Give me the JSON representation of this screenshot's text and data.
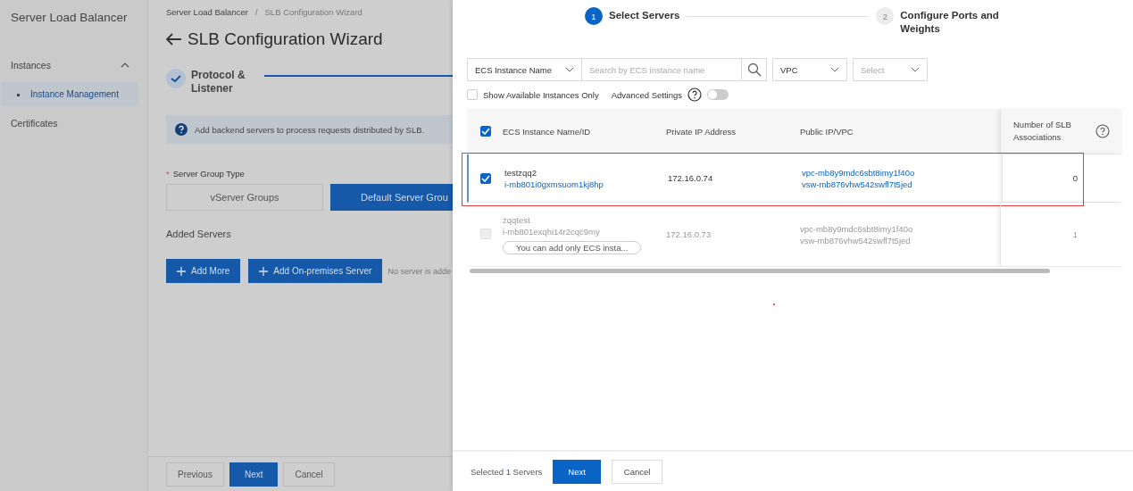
{
  "sidebar": {
    "title": "Server Load Balancer",
    "group": {
      "label": "Instances",
      "expanded": true
    },
    "items": [
      {
        "label": "Instance Management",
        "selected": true
      }
    ],
    "links": [
      "Certificates"
    ]
  },
  "page": {
    "breadcrumb": [
      "Server Load Balancer",
      "SLB Configuration Wizard"
    ],
    "breadcrumb_separator": "/",
    "required_mark": "*",
    "title": "SLB Configuration Wizard",
    "step": {
      "label": "Protocol & Listener",
      "done": true
    },
    "notice": "Add backend servers to process requests distributed by SLB.",
    "group_type_label": "Server Group Type",
    "group_types": [
      {
        "label": "vServer Groups",
        "selected": false
      },
      {
        "label": "Default Server Grou",
        "selected": true
      }
    ],
    "added_servers": "Added Servers",
    "add_buttons": [
      "Add More",
      "Add On-premises Server"
    ],
    "empty_note": "No server is adde",
    "footer_buttons": [
      {
        "label": "Previous",
        "kind": "default"
      },
      {
        "label": "Next",
        "kind": "primary"
      },
      {
        "label": "Cancel",
        "kind": "default"
      }
    ]
  },
  "drawer": {
    "steps": [
      {
        "number": "1",
        "label": "Select Servers",
        "selected": true
      },
      {
        "number": "2",
        "label": "Configure Ports and Weights",
        "selected": false
      }
    ],
    "filter": {
      "field": "ECS Instance Name",
      "placeholder": "Search by ECS instance name",
      "network": "VPC",
      "select_placeholder": "Select"
    },
    "show_available": {
      "label": "Show Available Instances Only",
      "checked": false
    },
    "advanced": {
      "label": "Advanced Settings",
      "on": false
    },
    "table": {
      "all_checked": true,
      "columns": [
        "ECS Instance Name/ID",
        "Private IP Address",
        "Public IP/VPC",
        "Number of SLB Associations"
      ],
      "rows": [
        {
          "name": "testzqq2",
          "id": "i-mb801i0gxmsuom1kj8hp",
          "private_ip": "172.16.0.74",
          "vpc": "vpc-mb8y9mdc6sbt8imy1f40o",
          "vswitch": "vsw-mb876vhw542swfl7t5jed",
          "associations": "0",
          "checked": true,
          "disabled": false,
          "highlighted": true
        },
        {
          "name": "zqqtest",
          "id": "i-mb801exqhi14r2cqc9my",
          "private_ip": "172.16.0.73",
          "vpc": "vpc-mb8y9mdc6sbt8imy1f40o",
          "vswitch": "vsw-mb876vhw542swfl7t5jed",
          "associations": "1",
          "checked": false,
          "disabled": true,
          "highlighted": false,
          "hint": "You can add only ECS insta..."
        }
      ]
    },
    "footer": {
      "selected_prefix": "Selected",
      "selected_count": "1",
      "selected_suffix": "Servers",
      "buttons": [
        {
          "label": "Next",
          "kind": "primary"
        },
        {
          "label": "Cancel",
          "kind": "default"
        }
      ]
    }
  }
}
